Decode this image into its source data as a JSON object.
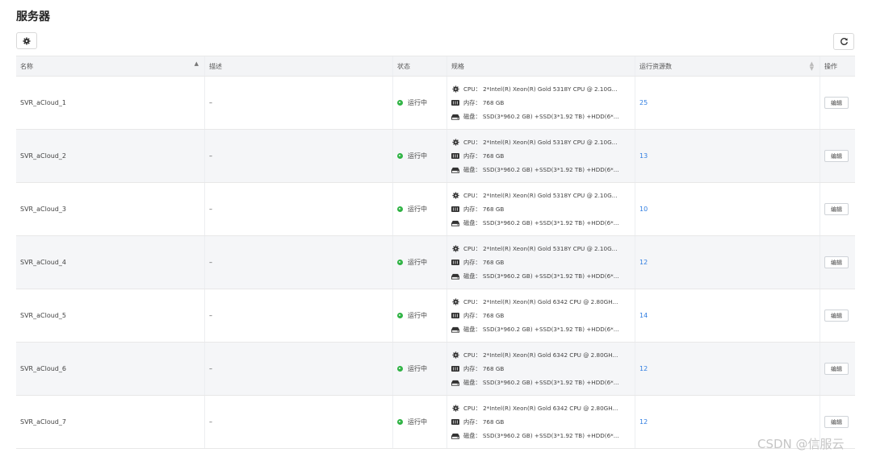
{
  "page": {
    "title": "服务器"
  },
  "toolbar": {
    "settings_icon": "gear-icon",
    "refresh_icon": "refresh-icon"
  },
  "table": {
    "headers": {
      "name": "名称",
      "description": "描述",
      "status": "状态",
      "spec": "规格",
      "running_resources": "运行资源数",
      "actions": "操作"
    },
    "rows": [
      {
        "name": "SVR_aCloud_1",
        "description": "–",
        "status": "运行中",
        "cpu": "CPU：  2*Intel(R) Xeon(R) Gold 5318Y CPU @ 2.10G...",
        "memory": "内存：  768 GB",
        "disk": "磁盘：  SSD(3*960.2 GB) +SSD(3*1.92 TB) +HDD(6*...",
        "running_resources": "25",
        "edit_label": "编辑"
      },
      {
        "name": "SVR_aCloud_2",
        "description": "–",
        "status": "运行中",
        "cpu": "CPU：  2*Intel(R) Xeon(R) Gold 5318Y CPU @ 2.10G...",
        "memory": "内存：  768 GB",
        "disk": "磁盘：  SSD(3*960.2 GB) +SSD(3*1.92 TB) +HDD(6*...",
        "running_resources": "13",
        "edit_label": "编辑"
      },
      {
        "name": "SVR_aCloud_3",
        "description": "–",
        "status": "运行中",
        "cpu": "CPU：  2*Intel(R) Xeon(R) Gold 5318Y CPU @ 2.10G...",
        "memory": "内存：  768 GB",
        "disk": "磁盘：  SSD(3*960.2 GB) +SSD(3*1.92 TB) +HDD(6*...",
        "running_resources": "10",
        "edit_label": "编辑"
      },
      {
        "name": "SVR_aCloud_4",
        "description": "–",
        "status": "运行中",
        "cpu": "CPU：  2*Intel(R) Xeon(R) Gold 5318Y CPU @ 2.10G...",
        "memory": "内存：  768 GB",
        "disk": "磁盘：  SSD(3*960.2 GB) +SSD(3*1.92 TB) +HDD(6*...",
        "running_resources": "12",
        "edit_label": "编辑"
      },
      {
        "name": "SVR_aCloud_5",
        "description": "–",
        "status": "运行中",
        "cpu": "CPU：  2*Intel(R) Xeon(R) Gold 6342 CPU @ 2.80GH...",
        "memory": "内存：  768 GB",
        "disk": "磁盘：  SSD(3*960.2 GB) +SSD(3*1.92 TB) +HDD(6*...",
        "running_resources": "14",
        "edit_label": "编辑"
      },
      {
        "name": "SVR_aCloud_6",
        "description": "–",
        "status": "运行中",
        "cpu": "CPU：  2*Intel(R) Xeon(R) Gold 6342 CPU @ 2.80GH...",
        "memory": "内存：  768 GB",
        "disk": "磁盘：  SSD(3*960.2 GB) +SSD(3*1.92 TB) +HDD(6*...",
        "running_resources": "12",
        "edit_label": "编辑"
      },
      {
        "name": "SVR_aCloud_7",
        "description": "–",
        "status": "运行中",
        "cpu": "CPU：  2*Intel(R) Xeon(R) Gold 6342 CPU @ 2.80GH...",
        "memory": "内存：  768 GB",
        "disk": "磁盘：  SSD(3*960.2 GB) +SSD(3*1.92 TB) +HDD(6*...",
        "running_resources": "12",
        "edit_label": "编辑"
      }
    ]
  },
  "watermark": "CSDN @信服云",
  "colors": {
    "status_running": "#2fb344",
    "link": "#2f7de1",
    "header_bg": "#f3f4f6",
    "row_alt_bg": "#f5f6f8"
  }
}
